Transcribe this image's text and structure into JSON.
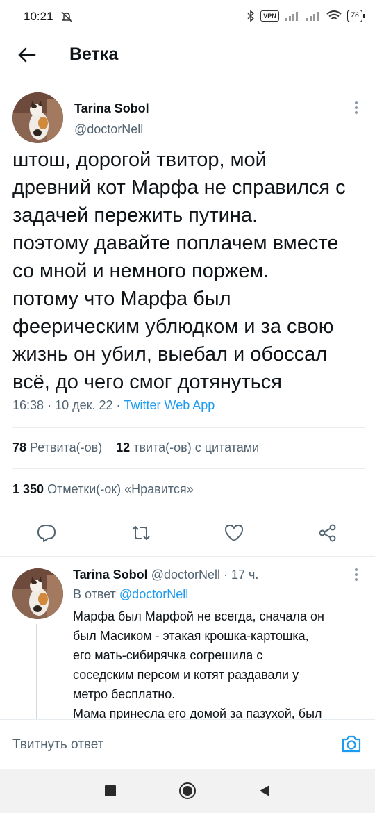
{
  "status_bar": {
    "time": "10:21",
    "vpn": "VPN",
    "battery": "76"
  },
  "header": {
    "title": "Ветка"
  },
  "tweet": {
    "author_name": "Tarina Sobol",
    "author_handle": "@doctorNell",
    "text_lines": [
      "штош, дорогой твитор, мой",
      "древний кот Марфа не справился с",
      "задачей пережить путина.",
      "поэтому давайте поплачем вместе",
      "со мной и немного поржем.",
      "потому что Марфа был",
      "феерическим ублюдком и за свою",
      "жизнь он убил, выебал и обоссал",
      "всё, до чего смог дотянуться"
    ],
    "time": "16:38",
    "date": "10 дек. 22",
    "source": "Twitter Web App",
    "retweets_count": "78",
    "retweets_label": "Ретвита(-ов)",
    "quotes_count": "12",
    "quotes_label": "твита(-ов) с цитатами",
    "likes_count": "1 350",
    "likes_label": "Отметки(-ок) «Нравится»"
  },
  "reply": {
    "author_name": "Tarina Sobol",
    "author_handle": "@doctorNell",
    "age": "17 ч.",
    "reply_prefix": "В ответ",
    "reply_to": "@doctorNell",
    "text_lines": [
      "Марфа был Марфой не всегда, сначала он",
      "был Масиком - этакая крошка-картошка,",
      "его мать-сибирячка согрешила с",
      "соседским персом и котят раздавали у",
      "метро бесплатно.",
      "Мама принесла его домой за пазухой, был"
    ]
  },
  "compose": {
    "placeholder": "Твитнуть ответ"
  },
  "colors": {
    "accent": "#1d9bf0",
    "secondary_text": "#536471",
    "primary_text": "#0f1419"
  }
}
